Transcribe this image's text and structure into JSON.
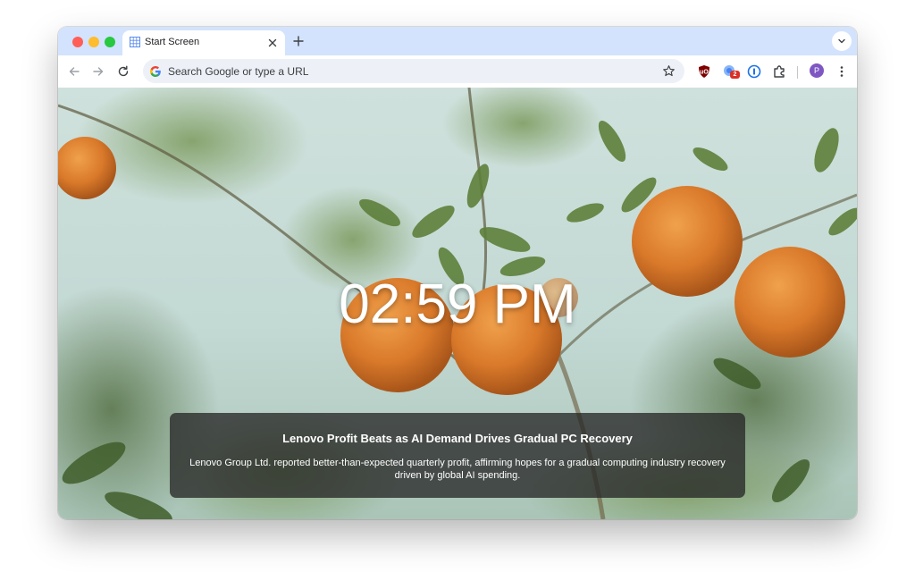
{
  "browser": {
    "tab": {
      "title": "Start Screen",
      "favicon": "grid-icon"
    },
    "new_tab": "plus-icon",
    "omnibox": {
      "placeholder": "Search Google or type a URL"
    },
    "extensions": [
      {
        "name": "ublock-icon"
      },
      {
        "name": "extension-badge-icon",
        "badge": "2"
      },
      {
        "name": "password-manager-icon"
      },
      {
        "name": "extensions-puzzle-icon"
      }
    ],
    "profile": {
      "initial": "P",
      "color": "#7e57c2"
    },
    "colors": {
      "tabstrip": "#d3e3fd",
      "omnibox": "#edf1f7"
    }
  },
  "start_screen": {
    "clock": "02:59 PM",
    "news": {
      "headline": "Lenovo Profit Beats as AI Demand Drives Gradual PC Recovery",
      "summary": "Lenovo Group Ltd. reported better-than-expected quarterly profit, affirming hopes for a gradual computing industry recovery driven by global AI spending."
    },
    "background": "orange-tree-photo"
  }
}
